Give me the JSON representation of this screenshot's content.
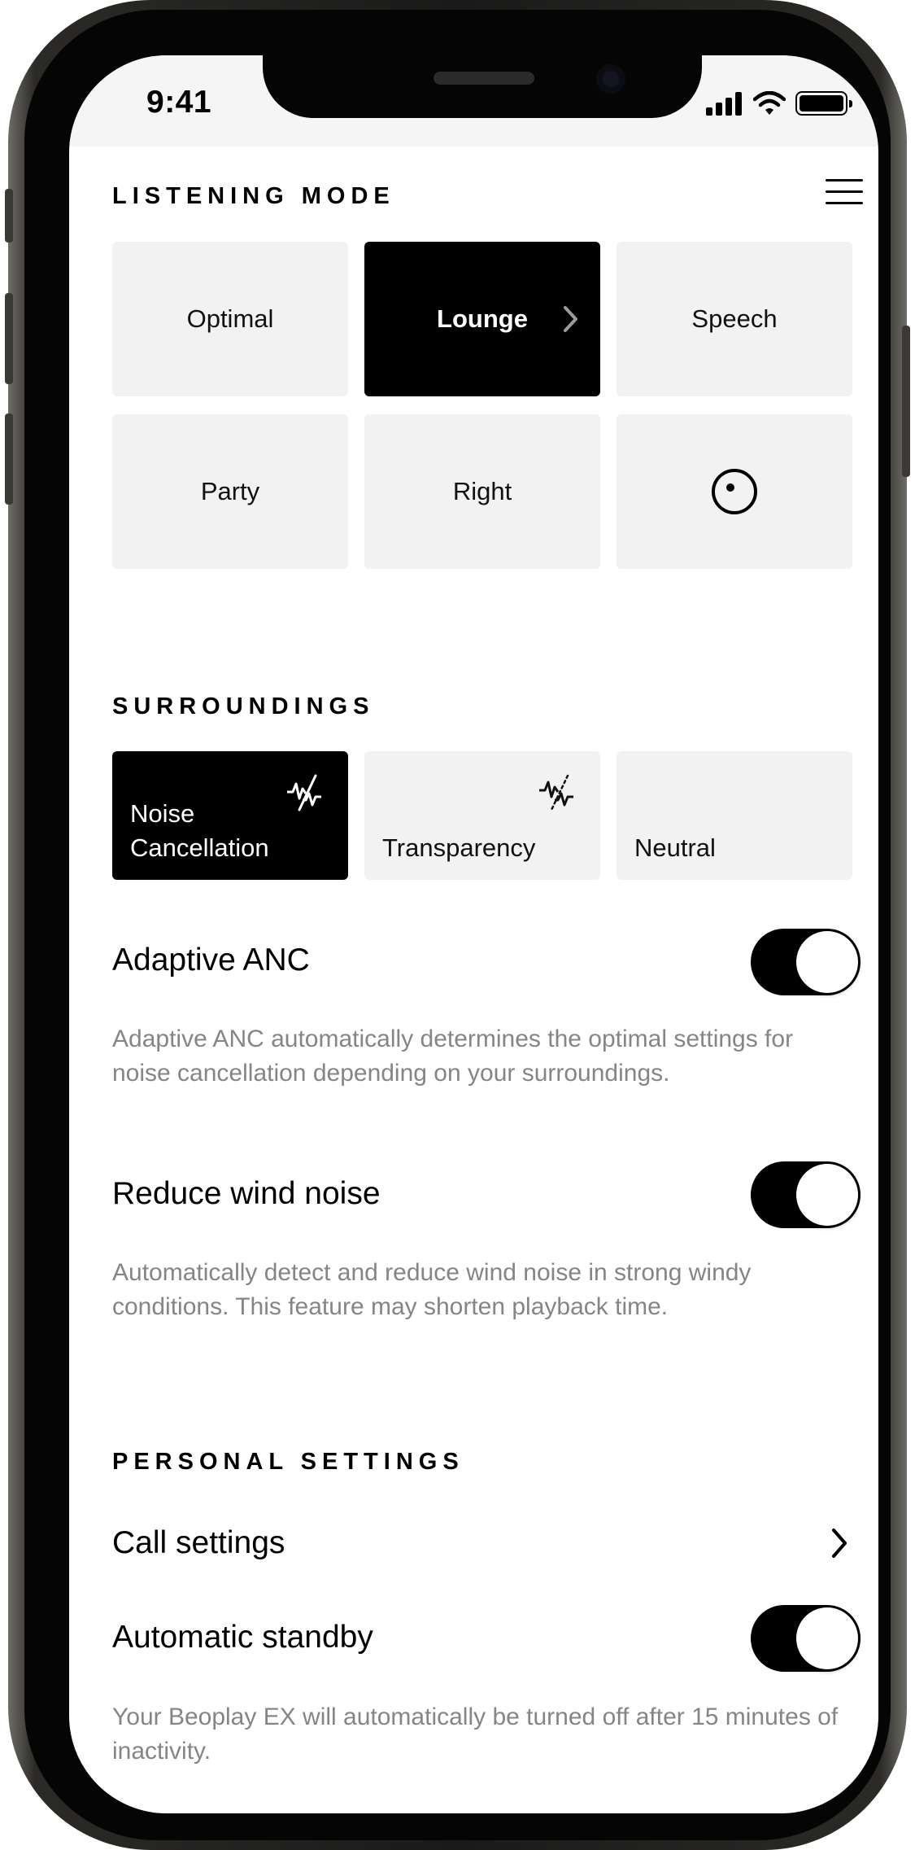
{
  "status_bar": {
    "time": "9:41",
    "icons": [
      "cellular-signal-icon",
      "wifi-icon",
      "battery-icon"
    ]
  },
  "listening_mode": {
    "title": "LISTENING MODE",
    "menu_icon": "hamburger-menu-icon",
    "modes": [
      {
        "label": "Optimal",
        "active": false
      },
      {
        "label": "Lounge",
        "active": true
      },
      {
        "label": "Speech",
        "active": false
      },
      {
        "label": "Party",
        "active": false
      },
      {
        "label": "Right",
        "active": false
      },
      {
        "label": "",
        "icon": "custom-mode-dot-icon",
        "active": false
      }
    ]
  },
  "surroundings": {
    "title": "SURROUNDINGS",
    "options": [
      {
        "label_line1": "Noise",
        "label_line2": "Cancellation",
        "icon": "noise-cancellation-icon",
        "active": true
      },
      {
        "label_line1": "",
        "label_line2": "Transparency",
        "icon": "transparency-icon",
        "active": false
      },
      {
        "label_line1": "",
        "label_line2": "Neutral",
        "active": false
      }
    ]
  },
  "settings": {
    "adaptive_anc": {
      "label": "Adaptive ANC",
      "enabled": true,
      "description": "Adaptive ANC automatically determines the optimal settings for noise cancellation depending on your surroundings."
    },
    "reduce_wind_noise": {
      "label": "Reduce wind noise",
      "enabled": true,
      "description": "Automatically detect and reduce wind noise in strong windy conditions. This feature may shorten playback time."
    }
  },
  "personal_settings": {
    "title": "PERSONAL SETTINGS",
    "call_settings": {
      "label": "Call settings"
    },
    "automatic_standby": {
      "label": "Automatic standby",
      "enabled": true,
      "description": "Your Beoplay EX will automatically be turned off after 15 minutes of inactivity."
    }
  },
  "colors": {
    "active_tile": "#000000",
    "inactive_tile": "#f2f2f2",
    "description_text": "#858585"
  }
}
